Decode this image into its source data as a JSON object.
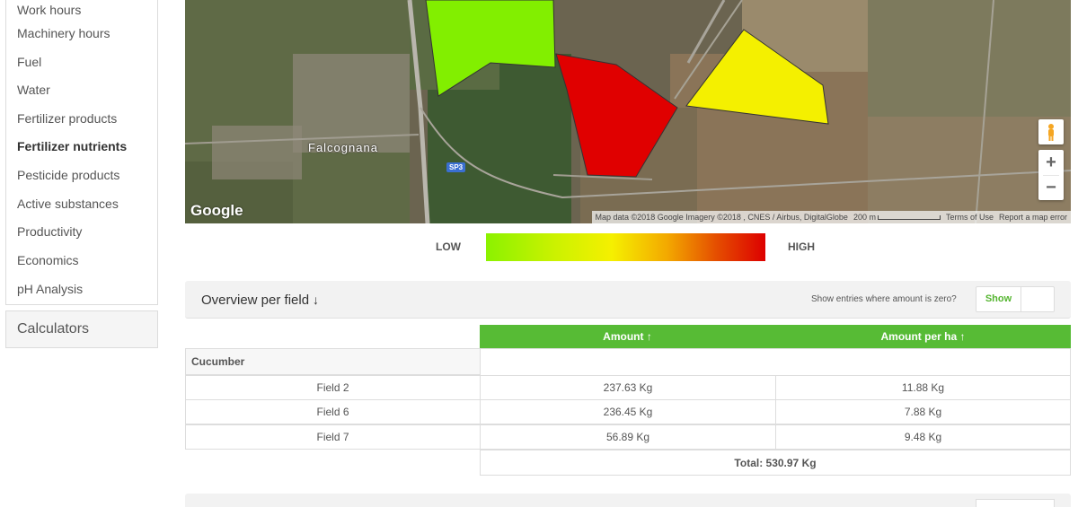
{
  "sidebar": {
    "items": [
      {
        "label": "Work hours",
        "active": false
      },
      {
        "label": "Machinery hours",
        "active": false
      },
      {
        "label": "Fuel",
        "active": false
      },
      {
        "label": "Water",
        "active": false
      },
      {
        "label": "Fertilizer products",
        "active": false
      },
      {
        "label": "Fertilizer nutrients",
        "active": true
      },
      {
        "label": "Pesticide products",
        "active": false
      },
      {
        "label": "Active substances",
        "active": false
      },
      {
        "label": "Productivity",
        "active": false
      },
      {
        "label": "Economics",
        "active": false
      },
      {
        "label": "pH Analysis",
        "active": false
      }
    ],
    "calculators_label": "Calculators"
  },
  "map": {
    "place_name": "Falcognana",
    "road_badge": "SP3",
    "google_logo": "Google",
    "attribution": "Map data ©2018 Google Imagery ©2018 , CNES / Airbus, DigitalGlobe",
    "scale_label": "200 m",
    "terms_label": "Terms of Use",
    "report_label": "Report a map error",
    "zoom_in": "+",
    "zoom_out": "−",
    "pegman_icon": "pegman-icon",
    "field_colors": {
      "green": "#82ef00",
      "red": "#e00000",
      "yellow": "#f4f000"
    }
  },
  "legend": {
    "low_label": "LOW",
    "high_label": "HIGH"
  },
  "overview": {
    "title": "Overview per field",
    "title_icon": "↓",
    "zero_question": "Show entries where amount is zero?",
    "show_label": "Show"
  },
  "table": {
    "headers": {
      "amount": "Amount ↑",
      "amount_per_ha": "Amount per ha ↑"
    },
    "group": "Cucumber",
    "rows": [
      {
        "field": "Field 2",
        "amount": "237.63 Kg",
        "per_ha": "11.88 Kg"
      },
      {
        "field": "Field 6",
        "amount": "236.45 Kg",
        "per_ha": "7.88 Kg"
      },
      {
        "field": "Field 7",
        "amount": "56.89 Kg",
        "per_ha": "9.48 Kg"
      }
    ],
    "total": "Total: 530.97 Kg"
  },
  "colors": {
    "accent_green": "#57bb35"
  }
}
